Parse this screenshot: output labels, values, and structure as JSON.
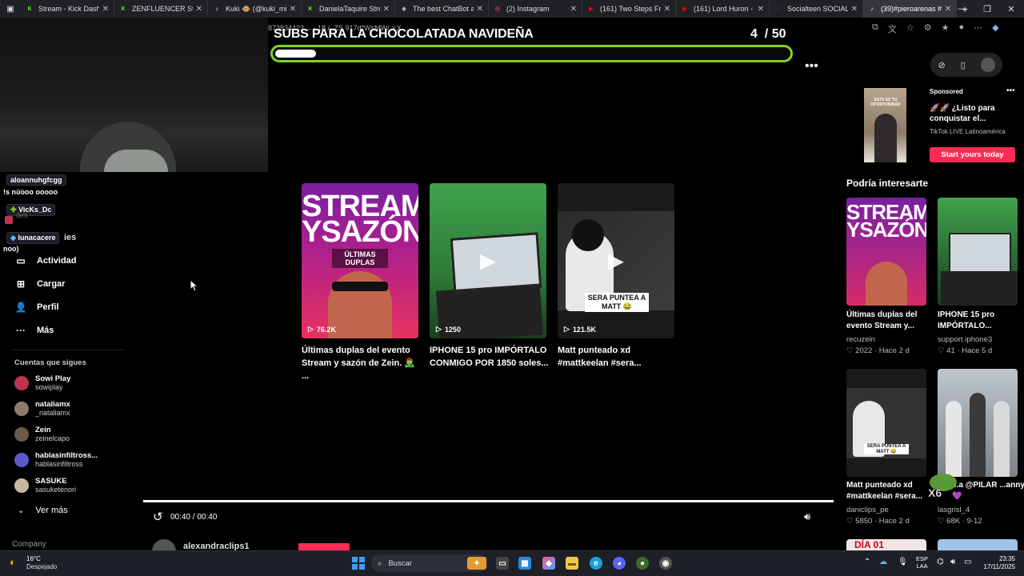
{
  "tabs": [
    {
      "title": "Stream - Kick Dashb",
      "icon": "kick-icon",
      "color": "#53fc18"
    },
    {
      "title": "ZENFLUENCER Stre",
      "icon": "kick-icon",
      "color": "#53fc18"
    },
    {
      "title": "Kuki 🐵 (@kuki_mi",
      "icon": "tiktok-icon",
      "color": "#ffffff"
    },
    {
      "title": "DanielaTaquire Stre",
      "icon": "kick-icon",
      "color": "#53fc18"
    },
    {
      "title": "The best ChatBot ai",
      "icon": "chatbot-icon",
      "color": "#bbbbbb"
    },
    {
      "title": "(2) Instagram",
      "icon": "instagram-icon",
      "color": "#e1306c"
    },
    {
      "title": "(161) Two Steps Fro",
      "icon": "youtube-icon",
      "color": "#ff0000"
    },
    {
      "title": "(161) Lord Huron -",
      "icon": "youtube-icon",
      "color": "#ff0000"
    },
    {
      "title": "Socialteen SOCIALT",
      "icon": "socialteen-icon",
      "color": "#333333"
    },
    {
      "title": "(39)#pieroarenas #",
      "icon": "tiktok-icon",
      "color": "#ffffff"
    }
  ],
  "url_ghost": "873834423 ←- 18 /- ZS 917d*WsMW/ ∨X",
  "goal": {
    "title": "SUBS PARA LA CHOCOLATADA NAVIDEÑA",
    "current": "4",
    "total": "/ 50",
    "progress": 0.08,
    "bar_color": "#7ed321"
  },
  "chat": {
    "user1": "aloannuhgfcgg",
    "msg1": "!s noooo ooooo",
    "user2": "VicKs_Dc",
    "user3": "lunacacere",
    "msg3": "noo)"
  },
  "nav": [
    {
      "label": "Actividad",
      "icon": "activity-icon"
    },
    {
      "label": "Cargar",
      "icon": "upload-icon"
    },
    {
      "label": "Perfil",
      "icon": "profile-icon"
    },
    {
      "label": "Más",
      "icon": "more-icon"
    }
  ],
  "ghost_nav": [
    "es",
    "des",
    "ies"
  ],
  "following": {
    "title": "Cuentas que sigues",
    "accounts": [
      {
        "name": "Sowi Play",
        "handle": "sowiplay",
        "color": "#c0334d"
      },
      {
        "name": "nataliamx",
        "handle": "_nataliamx",
        "color": "#8a7a6e"
      },
      {
        "name": "Zein",
        "handle": "zeinelcapo",
        "color": "#6b5a4a"
      },
      {
        "name": "hablasinfiltross...",
        "handle": "hablasinfiltross",
        "color": "#5a5ac8"
      },
      {
        "name": "SASUKE",
        "handle": "sasuketenori",
        "color": "#c9b8a0"
      }
    ],
    "see_more": "Ver más"
  },
  "company": "Company",
  "videos": [
    {
      "views": "76.2K",
      "title": "Últimas duplas del evento Stream y sazón de Zein. 🧟‍♂️ ...",
      "thumb_text_1": "STREAM",
      "thumb_text_2": "YSAZÓN",
      "thumb_badge": "ÚLTIMAS DUPLAS"
    },
    {
      "views": "1250",
      "title": "IPHONE 15 pro IMPÓRTALO CONMIGO POR 1850 soles..."
    },
    {
      "views": "121.5K",
      "title": "Matt punteado xd #mattkeelan #sera...",
      "thumb_caption": "SERA PUNTEA A MATT 😂"
    }
  ],
  "player": {
    "time": "00:40 / 00:40",
    "author": "alexandraclips1"
  },
  "sponsor": {
    "label": "Sponsored",
    "title": "🚀🚀 ¿Listo para conquistar el...",
    "subtitle": "TikTok LIVE Latinoamérica",
    "button": "Start yours today",
    "thumb_text": "ESTA ES TU OPORTUNIDAD"
  },
  "recommended": {
    "title": "Podría interesarte",
    "items": [
      {
        "title": "Últimas duplas del evento Stream y...",
        "author": "recuzein",
        "likes": "2022",
        "time": "Hace 2 d"
      },
      {
        "title": "IPHONE 15 pro IMPÓRTALO...",
        "author": "support.iphone3",
        "likes": "41",
        "time": "Hace 5 d"
      },
      {
        "title": "Matt punteado xd #mattkeelan #sera...",
        "author": "daniclips_pe",
        "likes": "5850",
        "time": "Hace 2 d"
      },
      {
        "title": "...a @PILAR ...anny 💜",
        "author": "lasgrisl_4",
        "likes": "68K",
        "time": "9-12"
      }
    ],
    "bottom_ghost": "DÍA 01"
  },
  "overlay_x6": "X6",
  "taskbar": {
    "temp": "16°C",
    "weather": "Despejado",
    "search": "Buscar",
    "lang1": "ESP",
    "lang2": "LAA",
    "time": "23:35",
    "date": "17/11/2025"
  }
}
